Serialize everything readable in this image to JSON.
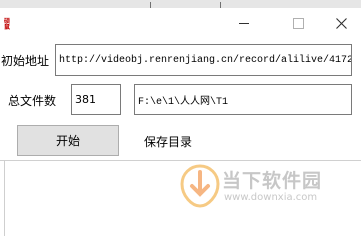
{
  "window": {
    "app_icon_text": "硕鼠",
    "controls": {
      "minimize": "–",
      "maximize": "□",
      "close": "✕"
    }
  },
  "form": {
    "url_label": "初始地址",
    "url_value": "http://videobj.renrenjiang.cn/record/alilive/4172",
    "count_label": "总文件数",
    "count_value": "381",
    "dir_value": "F:\\e\\1\\人人网\\T1",
    "start_button": "开始",
    "save_dir_label": "保存目录"
  },
  "watermark": {
    "title": "当下软件园",
    "url": "www.downxia.com",
    "icon": "downxia-logo-icon"
  }
}
